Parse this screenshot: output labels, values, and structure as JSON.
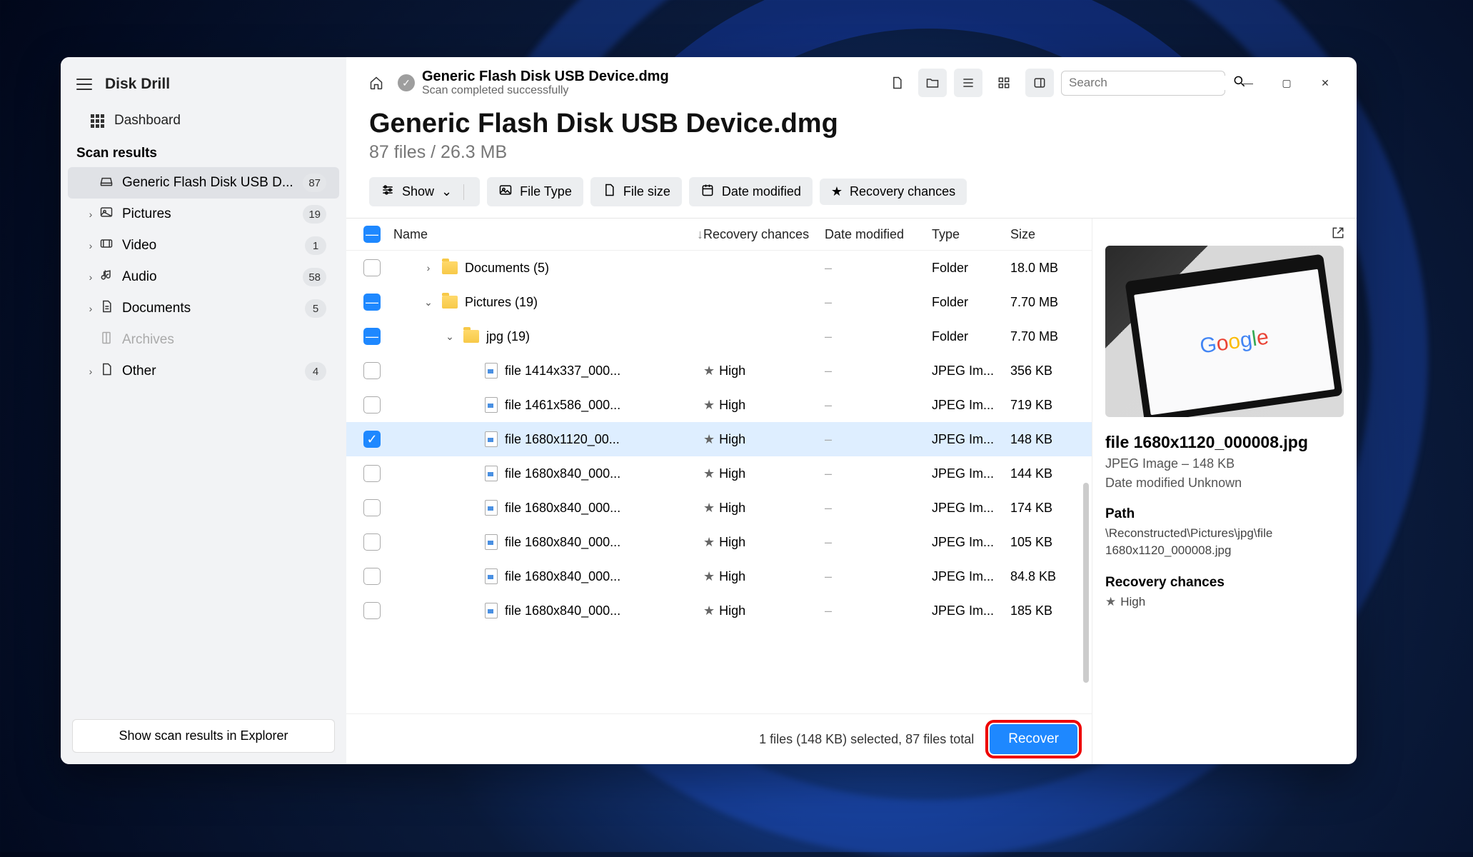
{
  "app_title": "Disk Drill",
  "sidebar": {
    "dashboard": "Dashboard",
    "scan_results_heading": "Scan results",
    "items": [
      {
        "label": "Generic Flash Disk USB D...",
        "badge": "87",
        "active": true,
        "icon": "drive"
      },
      {
        "label": "Pictures",
        "badge": "19",
        "expandable": true,
        "icon": "image"
      },
      {
        "label": "Video",
        "badge": "1",
        "expandable": true,
        "icon": "video"
      },
      {
        "label": "Audio",
        "badge": "58",
        "expandable": true,
        "icon": "audio"
      },
      {
        "label": "Documents",
        "badge": "5",
        "expandable": true,
        "icon": "doc"
      },
      {
        "label": "Archives",
        "disabled": true,
        "icon": "archive"
      },
      {
        "label": "Other",
        "badge": "4",
        "expandable": true,
        "icon": "other"
      }
    ],
    "explorer_btn": "Show scan results in Explorer"
  },
  "topbar": {
    "title": "Generic Flash Disk USB Device.dmg",
    "subtitle": "Scan completed successfully",
    "search_placeholder": "Search"
  },
  "page": {
    "h1": "Generic Flash Disk USB Device.dmg",
    "sub": "87 files / 26.3 MB"
  },
  "filters": {
    "show": "Show",
    "file_type": "File Type",
    "file_size": "File size",
    "date_modified": "Date modified",
    "recovery": "Recovery chances"
  },
  "columns": {
    "name": "Name",
    "recovery": "Recovery chances",
    "date": "Date modified",
    "type": "Type",
    "size": "Size"
  },
  "rows": [
    {
      "cb": "empty",
      "indent": 0,
      "exp": ">",
      "kind": "folder",
      "name": "Documents (5)",
      "rec": "",
      "date": "–",
      "type": "Folder",
      "size": "18.0 MB"
    },
    {
      "cb": "minus",
      "indent": 0,
      "exp": "v",
      "kind": "folder",
      "name": "Pictures (19)",
      "rec": "",
      "date": "–",
      "type": "Folder",
      "size": "7.70 MB"
    },
    {
      "cb": "minus",
      "indent": 1,
      "exp": "v",
      "kind": "folder",
      "name": "jpg (19)",
      "rec": "",
      "date": "–",
      "type": "Folder",
      "size": "7.70 MB"
    },
    {
      "cb": "empty",
      "indent": 2,
      "kind": "file",
      "name": "file 1414x337_000...",
      "rec": "High",
      "date": "–",
      "type": "JPEG Im...",
      "size": "356 KB"
    },
    {
      "cb": "empty",
      "indent": 2,
      "kind": "file",
      "name": "file 1461x586_000...",
      "rec": "High",
      "date": "–",
      "type": "JPEG Im...",
      "size": "719 KB"
    },
    {
      "cb": "check",
      "indent": 2,
      "kind": "file",
      "name": "file 1680x1120_00...",
      "rec": "High",
      "date": "–",
      "type": "JPEG Im...",
      "size": "148 KB",
      "sel": true
    },
    {
      "cb": "empty",
      "indent": 2,
      "kind": "file",
      "name": "file 1680x840_000...",
      "rec": "High",
      "date": "–",
      "type": "JPEG Im...",
      "size": "144 KB"
    },
    {
      "cb": "empty",
      "indent": 2,
      "kind": "file",
      "name": "file 1680x840_000...",
      "rec": "High",
      "date": "–",
      "type": "JPEG Im...",
      "size": "174 KB"
    },
    {
      "cb": "empty",
      "indent": 2,
      "kind": "file",
      "name": "file 1680x840_000...",
      "rec": "High",
      "date": "–",
      "type": "JPEG Im...",
      "size": "105 KB"
    },
    {
      "cb": "empty",
      "indent": 2,
      "kind": "file",
      "name": "file 1680x840_000...",
      "rec": "High",
      "date": "–",
      "type": "JPEG Im...",
      "size": "84.8 KB"
    },
    {
      "cb": "empty",
      "indent": 2,
      "kind": "file",
      "name": "file 1680x840_000...",
      "rec": "High",
      "date": "–",
      "type": "JPEG Im...",
      "size": "185 KB"
    }
  ],
  "preview": {
    "title": "file 1680x1120_000008.jpg",
    "meta": "JPEG Image – 148 KB",
    "date": "Date modified Unknown",
    "path_h": "Path",
    "path": "\\Reconstructed\\Pictures\\jpg\\file 1680x1120_000008.jpg",
    "rec_h": "Recovery chances",
    "rec": "High"
  },
  "footer": {
    "status": "1 files (148 KB) selected, 87 files total",
    "recover": "Recover"
  }
}
